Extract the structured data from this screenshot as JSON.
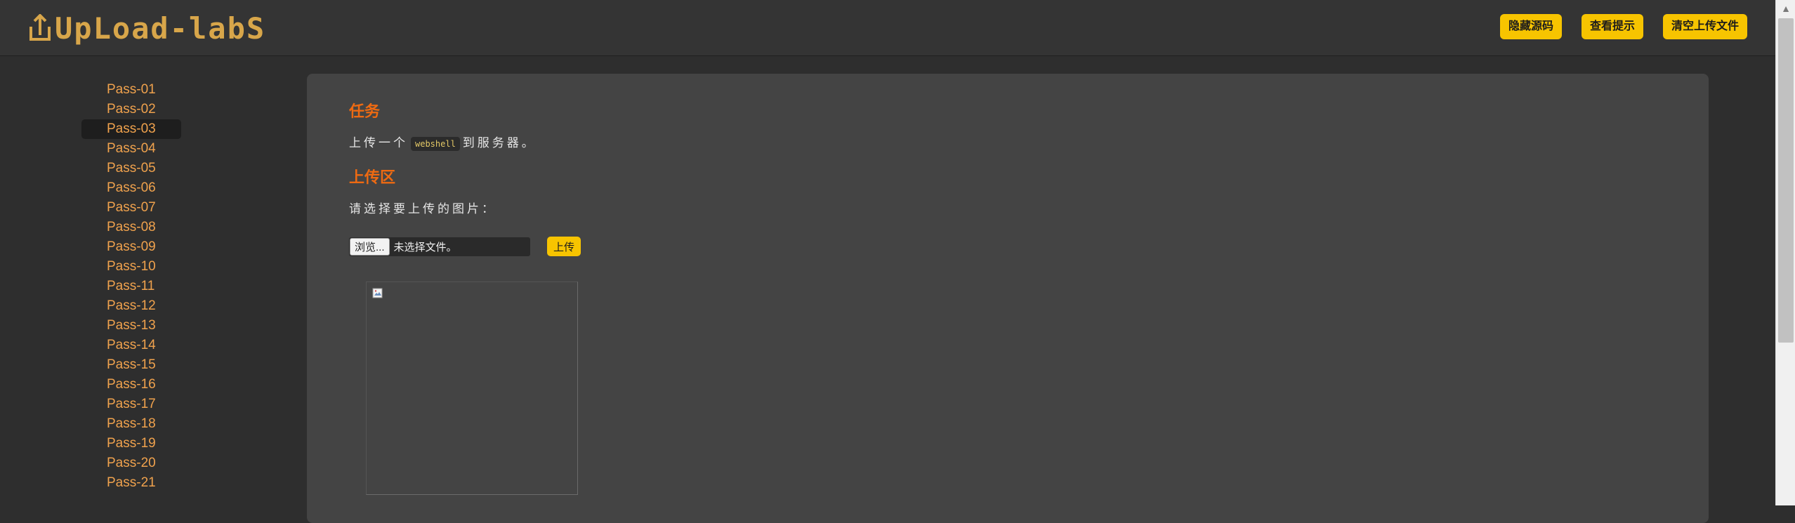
{
  "header": {
    "logo_text": "UpLoad-labS",
    "buttons": {
      "hide_source": "隐藏源码",
      "view_hint": "查看提示",
      "clear_uploads": "清空上传文件"
    }
  },
  "sidebar": {
    "items": [
      {
        "label": "Pass-01"
      },
      {
        "label": "Pass-02"
      },
      {
        "label": "Pass-03"
      },
      {
        "label": "Pass-04"
      },
      {
        "label": "Pass-05"
      },
      {
        "label": "Pass-06"
      },
      {
        "label": "Pass-07"
      },
      {
        "label": "Pass-08"
      },
      {
        "label": "Pass-09"
      },
      {
        "label": "Pass-10"
      },
      {
        "label": "Pass-11"
      },
      {
        "label": "Pass-12"
      },
      {
        "label": "Pass-13"
      },
      {
        "label": "Pass-14"
      },
      {
        "label": "Pass-15"
      },
      {
        "label": "Pass-16"
      },
      {
        "label": "Pass-17"
      },
      {
        "label": "Pass-18"
      },
      {
        "label": "Pass-19"
      },
      {
        "label": "Pass-20"
      },
      {
        "label": "Pass-21"
      }
    ],
    "active": "Pass-03"
  },
  "main": {
    "task_heading": "任务",
    "task_text_before": "上传一个",
    "task_code": "webshell",
    "task_text_after": "到服务器。",
    "upload_heading": "上传区",
    "upload_prompt": "请选择要上传的图片：",
    "file_input": {
      "browse_label": "浏览...",
      "status": "未选择文件。"
    },
    "upload_button": "上传"
  },
  "colors": {
    "accent_yellow": "#f7c400",
    "heading_orange": "#ee6a12",
    "nav_orange": "#f0a24d",
    "logo_gold": "#d8a64a"
  },
  "icons": {
    "scroll_up": "triangle-up",
    "preview": "broken-image-icon"
  }
}
